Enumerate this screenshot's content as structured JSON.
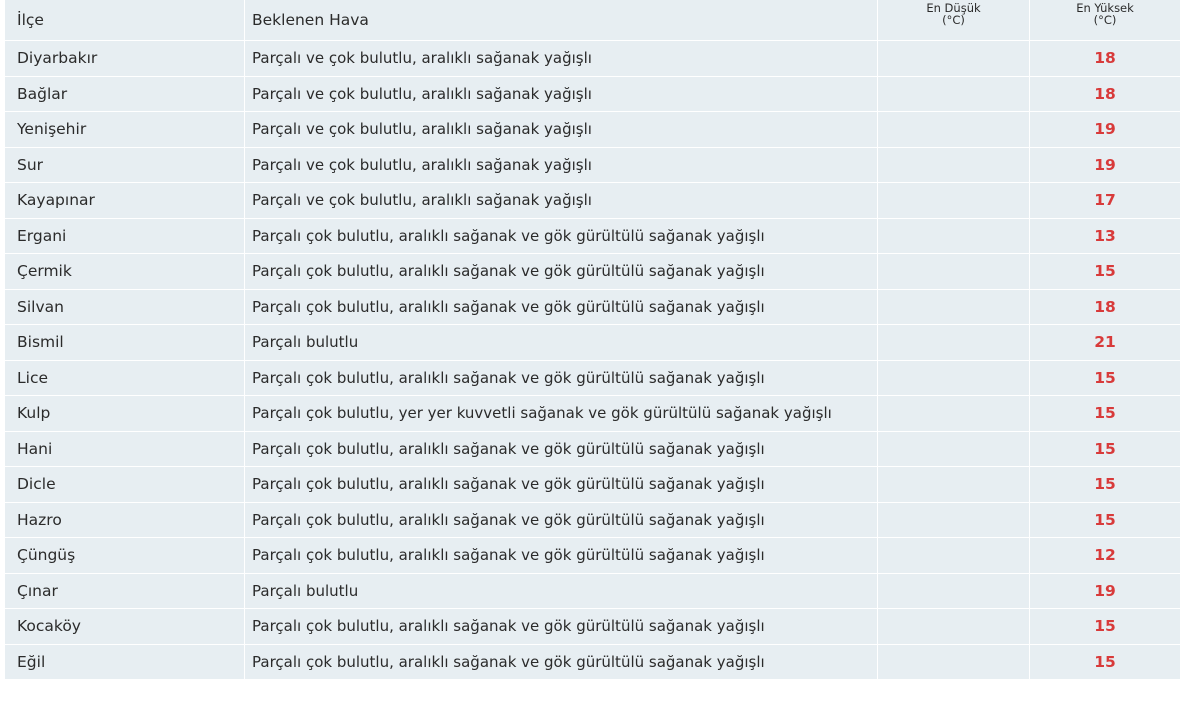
{
  "header": {
    "ilce": "İlçe",
    "hava": "Beklenen Hava",
    "min_line1": "En Düşük",
    "min_line2": "(°C)",
    "max_line1": "En Yüksek",
    "max_line2": "(°C)"
  },
  "colors": {
    "row_bg": "#e7eef2",
    "max_temp": "#d83a3a",
    "text": "#2b2b2b"
  },
  "rows": [
    {
      "ilce": "Diyarbakır",
      "hava": "Parçalı ve çok bulutlu, aralıklı sağanak yağışlı",
      "min": "",
      "max": "18"
    },
    {
      "ilce": "Bağlar",
      "hava": "Parçalı ve çok bulutlu, aralıklı sağanak yağışlı",
      "min": "",
      "max": "18"
    },
    {
      "ilce": "Yenişehir",
      "hava": "Parçalı ve çok bulutlu, aralıklı sağanak yağışlı",
      "min": "",
      "max": "19"
    },
    {
      "ilce": "Sur",
      "hava": "Parçalı ve çok bulutlu, aralıklı sağanak yağışlı",
      "min": "",
      "max": "19"
    },
    {
      "ilce": "Kayapınar",
      "hava": "Parçalı ve çok bulutlu, aralıklı sağanak yağışlı",
      "min": "",
      "max": "17"
    },
    {
      "ilce": "Ergani",
      "hava": "Parçalı çok bulutlu, aralıklı sağanak ve gök gürültülü sağanak yağışlı",
      "min": "",
      "max": "13"
    },
    {
      "ilce": "Çermik",
      "hava": "Parçalı çok bulutlu, aralıklı sağanak ve gök gürültülü sağanak yağışlı",
      "min": "",
      "max": "15"
    },
    {
      "ilce": "Silvan",
      "hava": "Parçalı çok bulutlu, aralıklı sağanak ve gök gürültülü sağanak yağışlı",
      "min": "",
      "max": "18"
    },
    {
      "ilce": "Bismil",
      "hava": "Parçalı bulutlu",
      "min": "",
      "max": "21"
    },
    {
      "ilce": "Lice",
      "hava": "Parçalı çok bulutlu, aralıklı sağanak ve gök gürültülü sağanak yağışlı",
      "min": "",
      "max": "15"
    },
    {
      "ilce": "Kulp",
      "hava": "Parçalı çok bulutlu, yer yer kuvvetli sağanak ve gök gürültülü sağanak yağışlı",
      "min": "",
      "max": "15"
    },
    {
      "ilce": "Hani",
      "hava": "Parçalı çok bulutlu, aralıklı sağanak ve gök gürültülü sağanak yağışlı",
      "min": "",
      "max": "15"
    },
    {
      "ilce": "Dicle",
      "hava": "Parçalı çok bulutlu, aralıklı sağanak ve gök gürültülü sağanak yağışlı",
      "min": "",
      "max": "15"
    },
    {
      "ilce": "Hazro",
      "hava": "Parçalı çok bulutlu, aralıklı sağanak ve gök gürültülü sağanak yağışlı",
      "min": "",
      "max": "15"
    },
    {
      "ilce": "Çüngüş",
      "hava": "Parçalı çok bulutlu, aralıklı sağanak ve gök gürültülü sağanak yağışlı",
      "min": "",
      "max": "12"
    },
    {
      "ilce": "Çınar",
      "hava": "Parçalı bulutlu",
      "min": "",
      "max": "19"
    },
    {
      "ilce": "Kocaköy",
      "hava": "Parçalı çok bulutlu, aralıklı sağanak ve gök gürültülü sağanak yağışlı",
      "min": "",
      "max": "15"
    },
    {
      "ilce": "Eğil",
      "hava": "Parçalı çok bulutlu, aralıklı sağanak ve gök gürültülü sağanak yağışlı",
      "min": "",
      "max": "15"
    }
  ]
}
